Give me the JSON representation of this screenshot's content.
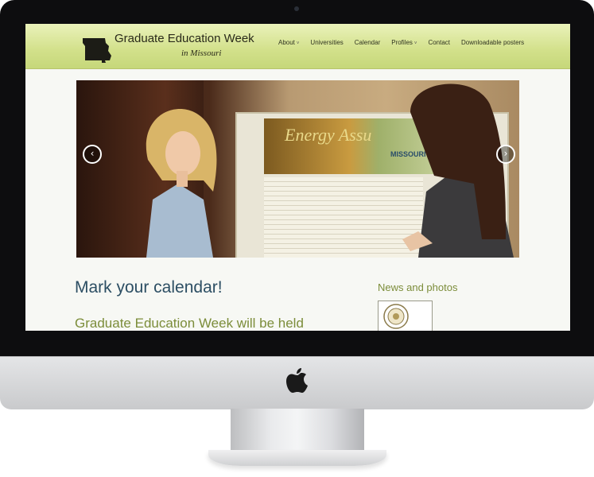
{
  "site": {
    "title": "Graduate Education Week",
    "subtitle": "in Missouri"
  },
  "nav": {
    "items": [
      {
        "label": "About",
        "has_dropdown": true
      },
      {
        "label": "Universities",
        "has_dropdown": false
      },
      {
        "label": "Calendar",
        "has_dropdown": false
      },
      {
        "label": "Profiles",
        "has_dropdown": true
      },
      {
        "label": "Contact",
        "has_dropdown": false
      },
      {
        "label": "Downloadable posters",
        "has_dropdown": false
      }
    ],
    "dropdown_caret": "˅"
  },
  "slider": {
    "poster_title": "Energy Assu",
    "poster_subtitle": "MISSOURI",
    "prev_icon": "‹",
    "next_icon": "›"
  },
  "content": {
    "calendar_heading": "Mark your calendar!",
    "event_heading": "Graduate Education Week will be held"
  },
  "sidebar": {
    "news_heading": "News and photos"
  },
  "colors": {
    "header_green": "#d2e08a",
    "heading_blue": "#2c4e63",
    "heading_olive": "#7c8d3a"
  },
  "icons": {
    "logo": "missouri-map-icon",
    "hardware": "apple-logo-icon"
  }
}
